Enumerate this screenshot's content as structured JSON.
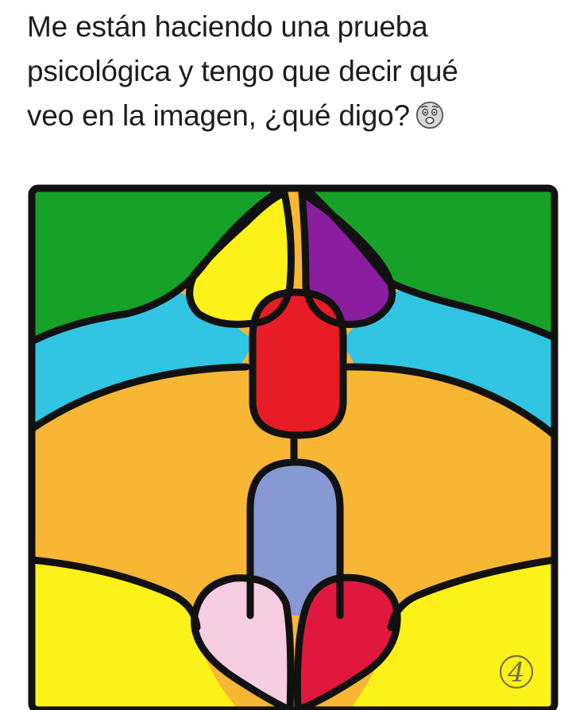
{
  "post": {
    "caption_lines": [
      "Me están haciendo una prueba",
      "psicológica y tengo que decir qué",
      "veo en la imagen, ¿qué digo?"
    ],
    "emoji": "astonished-face-emoji"
  },
  "artwork": {
    "signature": "4",
    "colors": {
      "green": "#16a128",
      "cyan": "#31c5e3",
      "orange": "#f7b634",
      "yellow": "#fdf11a",
      "purple": "#8a1e9e",
      "red": "#e81c24",
      "blue": "#8798d3",
      "pink": "#f6cde1",
      "crimson": "#e0183f",
      "outline": "#111111"
    }
  }
}
